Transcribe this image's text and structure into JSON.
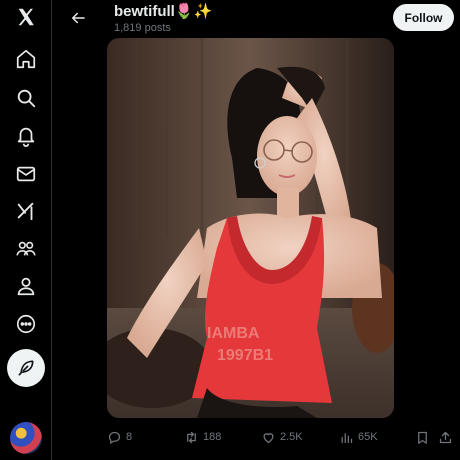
{
  "sidebar": {
    "items": [
      {
        "icon": "x-logo-icon"
      },
      {
        "icon": "home-icon"
      },
      {
        "icon": "search-icon"
      },
      {
        "icon": "bell-icon"
      },
      {
        "icon": "mail-icon"
      },
      {
        "icon": "grok-icon"
      },
      {
        "icon": "communities-icon"
      },
      {
        "icon": "profile-icon"
      },
      {
        "icon": "more-icon"
      }
    ],
    "post_icon": "feather-icon"
  },
  "header": {
    "name": "bewtifull",
    "name_emoji": "🌷✨",
    "post_count": "1,819 posts",
    "follow_label": "Follow"
  },
  "actions": {
    "replies": "8",
    "reposts": "188",
    "likes": "2.5K",
    "views": "65K"
  },
  "colors": {
    "background": "#000000",
    "text": "#e7e9ea",
    "muted": "#71767b",
    "button_bg": "#eff3f4",
    "top_red": "#e5383b"
  }
}
